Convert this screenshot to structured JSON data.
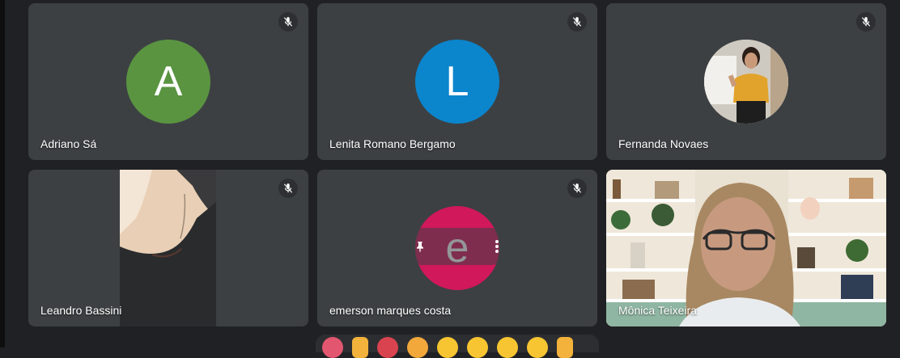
{
  "participants": [
    {
      "name": "Adriano Sá",
      "initial": "A",
      "color": "#5a9441",
      "muted": true
    },
    {
      "name": "Lenita Romano Bergamo",
      "initial": "L",
      "color": "#0b85cc",
      "muted": true
    },
    {
      "name": "Fernanda Novaes",
      "muted": true
    },
    {
      "name": "Leandro Bassini",
      "muted": true
    },
    {
      "name": "emerson marques costa",
      "initial": "e",
      "color": "#d0185b",
      "muted": true
    },
    {
      "name": "Mônica Teixeira",
      "muted": false
    }
  ],
  "icons": {
    "mute": "mic-off-icon",
    "pin": "pin-icon",
    "more": "more-vert-icon"
  },
  "reactions": [
    "heart",
    "thumbs-up",
    "party",
    "clap",
    "laugh",
    "surprised",
    "sad",
    "thinking",
    "thumbs-down"
  ]
}
